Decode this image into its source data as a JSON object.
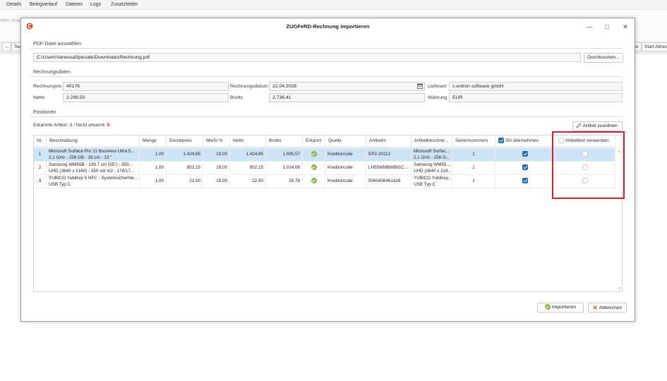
{
  "background": {
    "menu": [
      "Details",
      "Belegverlauf",
      "Dateien",
      "Logs",
      "Zusatzfelder"
    ],
    "scan_hint": "nern scanne",
    "button_left": "...",
    "button_tex": "Tex",
    "button_right1": "er",
    "button_right2": "Start Abrec"
  },
  "dialog": {
    "title": "ZUGFeRD-Rechnung importieren",
    "pdf_section": "PDF-Datei auswählen",
    "pdf_path": "C:\\Users\\VanessaSpeciale\\Downloads\\Rechnung.pdf",
    "browse_label": "Durchsuchen...",
    "invoice_section": "Rechnungsdaten",
    "labels": {
      "rechnungsnr": "Rechnungsnr.",
      "rechnungsdatum": "Rechnungsdatum",
      "lieferant": "Lieferant",
      "netto": "Netto",
      "brutto": "Brutto",
      "waehrung": "Währung"
    },
    "values": {
      "rechnungsnr": "40176",
      "rechnungsdatum": "22.04.2026",
      "lieferant": "c-entron software gmbH",
      "netto": "2.299,50",
      "brutto": "2.736,41",
      "waehrung": "EUR"
    },
    "positions_section": "Positionen",
    "recognized_label": "Erkannte Artikel:",
    "recognized_count": "3",
    "separator": "/",
    "not_recognized_label": "Nicht erkannt:",
    "not_recognized_count": "0",
    "assign_label": "Artikel zuordnen",
    "import_label": "Importieren",
    "cancel_label": "Abbrechen"
  },
  "grid": {
    "headers": [
      "Nr.",
      "Beschreibung",
      "Menge",
      "Einzelpreis",
      "MwSt %",
      "Netto",
      "Brutto",
      "Erkannt",
      "Quelle",
      "Artikelnr.",
      "Artikelbeschrei...",
      "Seriennummern",
      "SN übernehmen",
      "Artikeltext verwenden"
    ],
    "rows": [
      {
        "nr": "1",
        "desc1": "Microsoft Surface Pro 11 Business Ultra 5...",
        "desc2": "2,1 GHz - 256 GB - 33 cm - 13 \"",
        "menge": "1,00",
        "einzelpreis": "1.424,85",
        "mwst": "19,00",
        "netto": "1.424,85",
        "brutto": "1.695,57",
        "quelle": "Kreditorcode",
        "artikelnr": "EP2-20112",
        "ab1": "Microsoft Surfac...",
        "ab2": "2,1 GHz - 256 G...",
        "sn": "1"
      },
      {
        "nr": "2",
        "desc1": "Samsung WM55B - 139.7 cm (55\") - 350...",
        "desc2": "UHD (3840 x 2160) - 350 cd/ m2 - 178/17...",
        "menge": "1,00",
        "einzelpreis": "852,15",
        "mwst": "19,00",
        "netto": "852,15",
        "brutto": "1.014,06",
        "quelle": "Kreditorcode",
        "artikelnr": "LH55WMBWBGC...",
        "ab1": "Samsung WM55...",
        "ab2": "UHD (3840 x 216...",
        "sn": "1"
      },
      {
        "nr": "3",
        "desc1": "YUBICO YubiKey 5 NFC - Systemsicherhei...",
        "desc2": "USB Typ C",
        "menge": "1,00",
        "einzelpreis": "22,50",
        "mwst": "19,00",
        "netto": "22,50",
        "brutto": "26,78",
        "quelle": "Kreditorcode",
        "artikelnr": "5060408461426",
        "ab1": "YUBICO YubiKey...",
        "ab2": "USB Typ C",
        "sn": "1"
      }
    ]
  },
  "colors": {
    "accent": "#1e6bb8",
    "selection": "#cde4f7",
    "ok": "#8bb63f",
    "highlight": "#d0202a",
    "brand": "#d9482b"
  }
}
